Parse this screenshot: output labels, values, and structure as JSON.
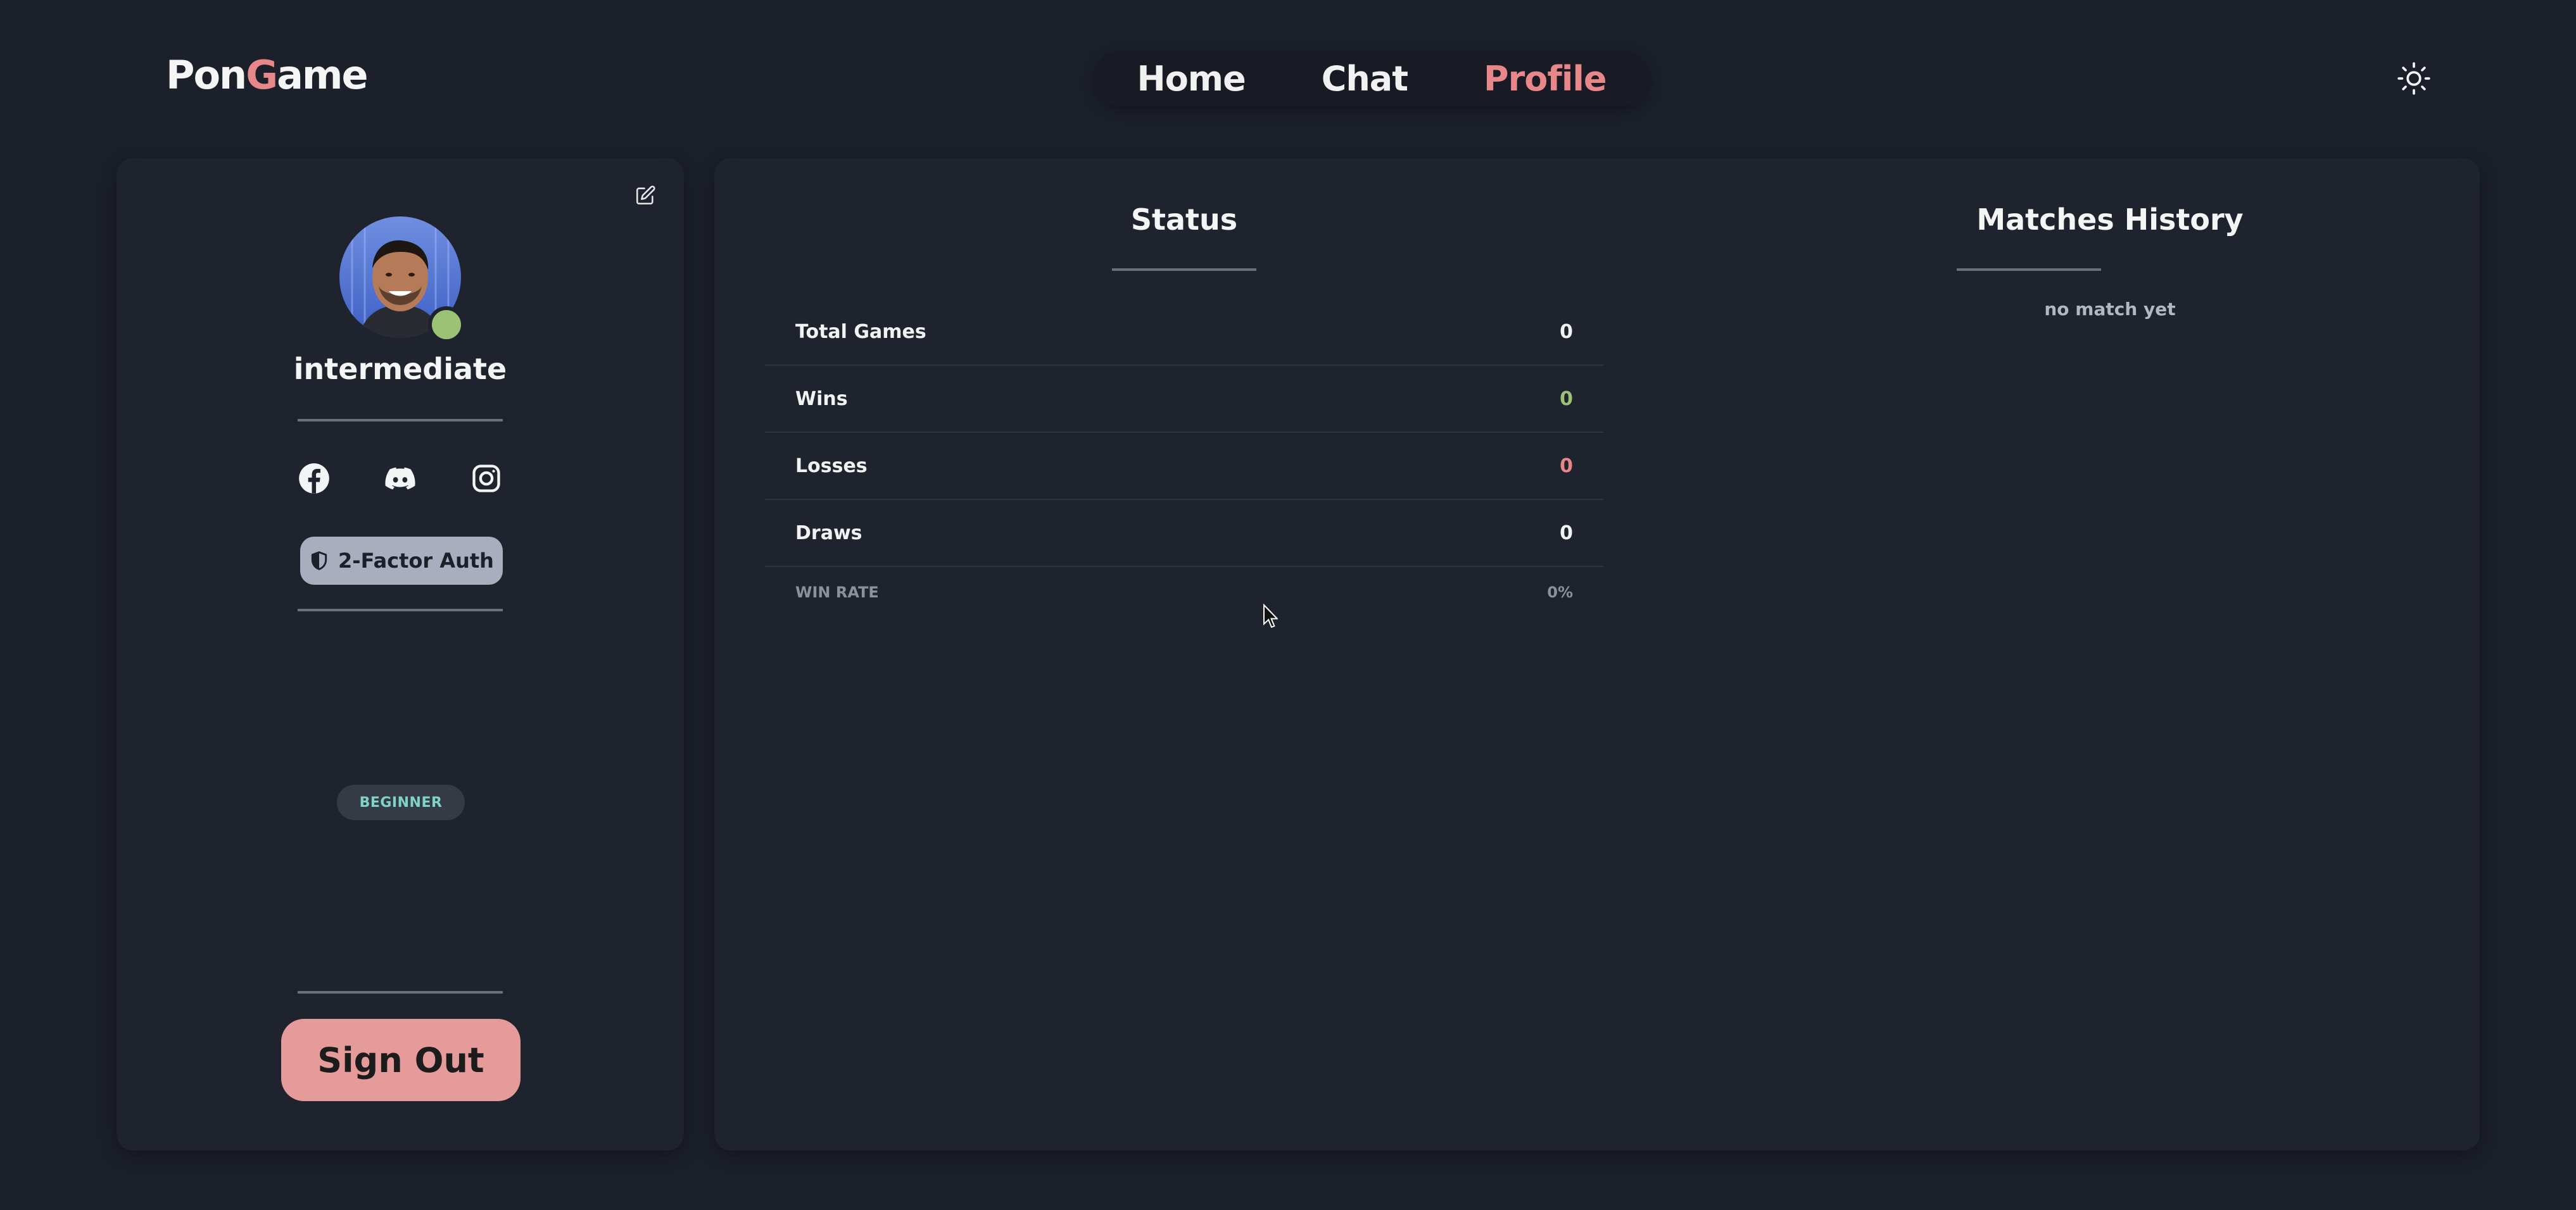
{
  "header": {
    "logo": {
      "part1": "Pon",
      "part2": "G",
      "part3": "ame"
    },
    "nav": [
      {
        "label": "Home",
        "active": false
      },
      {
        "label": "Chat",
        "active": false
      },
      {
        "label": "Profile",
        "active": true
      }
    ],
    "theme_toggle_icon": "sun-icon"
  },
  "profile": {
    "edit_icon": "edit-icon",
    "username": "intermediate",
    "online": true,
    "socials": [
      "facebook-icon",
      "discord-icon",
      "instagram-icon"
    ],
    "tfa_label": "2-Factor Auth",
    "level_badge": "BEGINNER",
    "signout_label": "Sign Out"
  },
  "status": {
    "title": "Status",
    "rows": [
      {
        "label": "Total Games",
        "value": "0"
      },
      {
        "label": "Wins",
        "value": "0"
      },
      {
        "label": "Losses",
        "value": "0"
      },
      {
        "label": "Draws",
        "value": "0"
      }
    ],
    "win_rate_label": "WIN RATE",
    "win_rate_value": "0%"
  },
  "matches": {
    "title": "Matches History",
    "empty_text": "no match yet"
  },
  "colors": {
    "background": "#1c202a",
    "card": "#1f232d",
    "accent": "#e8878a",
    "online": "#9cc276",
    "level_text": "#7ed3c8"
  }
}
